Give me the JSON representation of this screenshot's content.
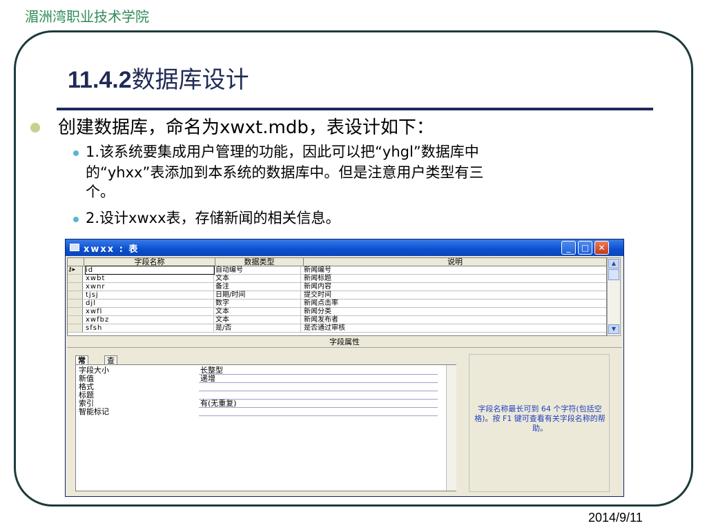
{
  "college_name": "湄洲湾职业技术学院",
  "slide": {
    "title_num": "11.4.2",
    "title_text": "数据库设计",
    "bullet1": "创建数据库，命名为xwxt.mdb，表设计如下：",
    "sub1_line1": "1.该系统要集成用户管理的功能，因此可以把“yhgl”数据库中",
    "sub1_line2": "的“yhxx”表添加到本系统的数据库中。但是注意用户类型有三",
    "sub1_line3": "个。",
    "sub2": "2.设计xwxx表，存储新闻的相关信息。",
    "date": "2014/9/11"
  },
  "window": {
    "title": "xwxx : 表",
    "btn_min": "_",
    "btn_max": "□",
    "btn_close": "✕",
    "col_headers": [
      "字段名称",
      "数据类型",
      "说明"
    ],
    "rows": [
      {
        "sel": "⚷▸",
        "name": "id",
        "type": "自动编号",
        "desc": "新闻编号"
      },
      {
        "sel": "",
        "name": "xwbt",
        "type": "文本",
        "desc": "新闻标题"
      },
      {
        "sel": "",
        "name": "xwnr",
        "type": "备注",
        "desc": "新闻内容"
      },
      {
        "sel": "",
        "name": "tjsj",
        "type": "日期/时间",
        "desc": "提交时间"
      },
      {
        "sel": "",
        "name": "djl",
        "type": "数字",
        "desc": "新闻点击率"
      },
      {
        "sel": "",
        "name": "xwfl",
        "type": "文本",
        "desc": "新闻分类"
      },
      {
        "sel": "",
        "name": "xwfbz",
        "type": "文本",
        "desc": "新闻发布者"
      },
      {
        "sel": "",
        "name": "sfsh",
        "type": "是/否",
        "desc": "是否通过审核"
      }
    ],
    "props_header": "字段属性",
    "tabs": [
      "常规",
      "查阅"
    ],
    "props": [
      {
        "key": "字段大小",
        "value": "长整型"
      },
      {
        "key": "新值",
        "value": "递增"
      },
      {
        "key": "格式",
        "value": ""
      },
      {
        "key": "标题",
        "value": ""
      },
      {
        "key": "索引",
        "value": "有(无重复)"
      },
      {
        "key": "智能标记",
        "value": ""
      }
    ],
    "help_text": "字段名称最长可到 64 个字符(包括空格)。按 F1 键可查看有关字段名称的帮助。"
  }
}
